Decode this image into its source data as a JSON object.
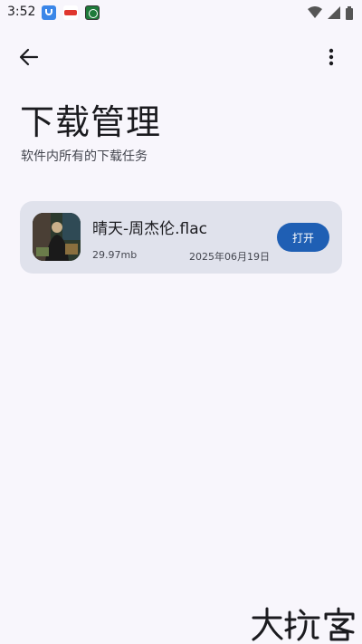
{
  "status_bar": {
    "time": "3:52",
    "notification_icons": [
      "app-notification-icon",
      "app-notification-icon",
      "app-notification-icon"
    ],
    "system_icons": [
      "wifi-icon",
      "signal-icon",
      "battery-icon"
    ]
  },
  "toolbar": {
    "back_icon": "arrow-back-icon",
    "more_icon": "more-vert-icon"
  },
  "header": {
    "title": "下载管理",
    "subtitle": "软件内所有的下载任务"
  },
  "downloads": [
    {
      "name": "晴天-周杰伦.flac",
      "size": "29.97mb",
      "date": "2025年06月19日",
      "action_label": "打开"
    }
  ],
  "watermark": {
    "text": "大玩客"
  },
  "colors": {
    "background": "#f8f6fc",
    "card": "#e0e2ec",
    "accent": "#1f5fb4"
  }
}
